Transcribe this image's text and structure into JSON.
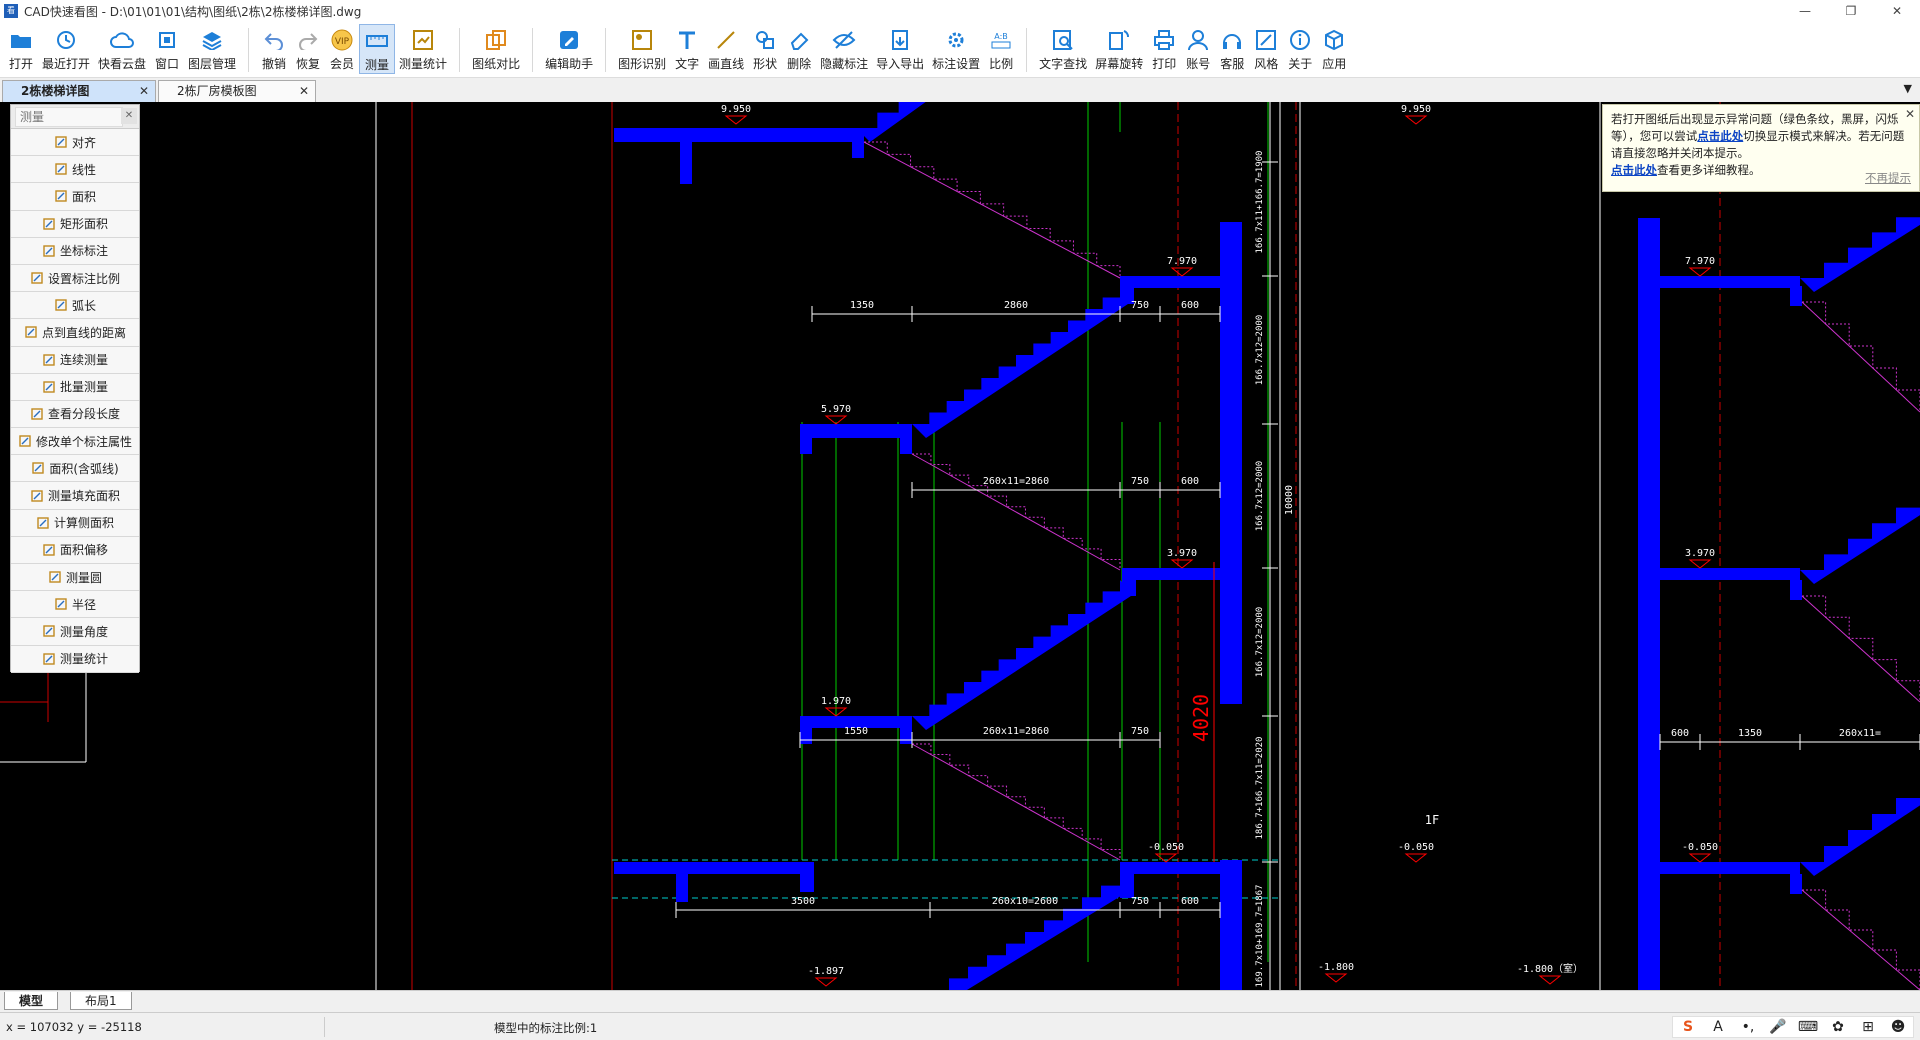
{
  "window": {
    "title": "CAD快速看图 - D:\\01\\01\\01\\结构\\图纸\\2栋\\2栋楼梯详图.dwg",
    "icon_label": "看图",
    "buttons": {
      "minimize": "—",
      "restore": "❐",
      "close": "✕"
    }
  },
  "toolbar": {
    "groups": [
      [
        {
          "label": "打开",
          "icon": "folder-icon"
        },
        {
          "label": "最近打开",
          "icon": "history-icon"
        },
        {
          "label": "快看云盘",
          "icon": "cloud-icon"
        },
        {
          "label": "窗口",
          "icon": "window-icon"
        },
        {
          "label": "图层管理",
          "icon": "layers-icon"
        }
      ],
      [
        {
          "label": "撤销",
          "icon": "undo-icon"
        },
        {
          "label": "恢复",
          "icon": "redo-icon"
        },
        {
          "label": "会员",
          "icon": "vip-icon"
        },
        {
          "label": "测量",
          "icon": "ruler-icon",
          "active": true
        },
        {
          "label": "测量统计",
          "icon": "measure-stats-icon"
        }
      ],
      [
        {
          "label": "图纸对比",
          "icon": "compare-icon"
        }
      ],
      [
        {
          "label": "编辑助手",
          "icon": "edit-assistant-icon"
        }
      ],
      [
        {
          "label": "图形识别",
          "icon": "shape-recognize-icon"
        },
        {
          "label": "文字",
          "icon": "text-icon"
        },
        {
          "label": "画直线",
          "icon": "line-icon"
        },
        {
          "label": "形状",
          "icon": "shape-icon"
        },
        {
          "label": "删除",
          "icon": "eraser-icon"
        },
        {
          "label": "隐藏标注",
          "icon": "hide-eye-icon"
        },
        {
          "label": "导入导出",
          "icon": "import-export-icon"
        },
        {
          "label": "标注设置",
          "icon": "annotation-settings-icon"
        },
        {
          "label": "比例",
          "icon": "scale-icon"
        }
      ],
      [
        {
          "label": "文字查找",
          "icon": "text-search-icon"
        },
        {
          "label": "屏幕旋转",
          "icon": "rotate-icon"
        },
        {
          "label": "打印",
          "icon": "print-icon"
        },
        {
          "label": "账号",
          "icon": "user-icon"
        },
        {
          "label": "客服",
          "icon": "headset-icon"
        },
        {
          "label": "风格",
          "icon": "style-icon"
        },
        {
          "label": "关于",
          "icon": "info-icon"
        },
        {
          "label": "应用",
          "icon": "cube-icon"
        }
      ]
    ]
  },
  "doc_tabs": [
    {
      "label": "2栋楼梯详图",
      "active": true,
      "close": "✕"
    },
    {
      "label": "2栋厂房模板图",
      "active": false,
      "close": "✕"
    }
  ],
  "doc_tabs_menu": "▼",
  "measure_panel": {
    "placeholder": "测量",
    "close": "✕",
    "items": [
      {
        "label": "对齐",
        "icon": "align-measure-icon"
      },
      {
        "label": "线性",
        "icon": "linear-measure-icon"
      },
      {
        "label": "面积",
        "icon": "area-icon"
      },
      {
        "label": "矩形面积",
        "icon": "rect-area-icon"
      },
      {
        "label": "坐标标注",
        "icon": "coordinate-icon"
      },
      {
        "label": "设置标注比例",
        "icon": "set-scale-icon"
      },
      {
        "label": "弧长",
        "icon": "arc-length-icon"
      },
      {
        "label": "点到直线的距离",
        "icon": "point-line-distance-icon"
      },
      {
        "label": "连续测量",
        "icon": "continuous-measure-icon"
      },
      {
        "label": "批量测量",
        "icon": "batch-measure-icon"
      },
      {
        "label": "查看分段长度",
        "icon": "segment-length-icon"
      },
      {
        "label": "修改单个标注属性",
        "icon": "edit-annotation-icon"
      },
      {
        "label": "面积(含弧线)",
        "icon": "arc-area-icon"
      },
      {
        "label": "测量填充面积",
        "icon": "fill-area-icon"
      },
      {
        "label": "计算侧面积",
        "icon": "side-area-icon"
      },
      {
        "label": "面积偏移",
        "icon": "area-offset-icon"
      },
      {
        "label": "测量圆",
        "icon": "circle-measure-icon"
      },
      {
        "label": "半径",
        "icon": "radius-icon"
      },
      {
        "label": "测量角度",
        "icon": "angle-icon"
      },
      {
        "label": "测量统计",
        "icon": "measure-stats-icon"
      }
    ]
  },
  "notice": {
    "line1": "若打开图纸后出现显示异常问题（绿色条纹，黑屏，闪烁等），您可以尝试",
    "link1": "点击此处",
    "line2": "切换显示模式来解决。若无问题请直接忽略并关闭本提示。",
    "link2": "点击此处",
    "line3": "查看更多详细教程。",
    "dismiss": "不再提示",
    "close": "✕"
  },
  "drawing": {
    "elevations": [
      "9.950",
      "9.950",
      "7.970",
      "7.970",
      "5.970",
      "3.970",
      "3.970",
      "1.970",
      "-0.050",
      "-0.050",
      "-0.050",
      "-1.897",
      "-1.800",
      "-1.800（室）"
    ],
    "dims": [
      "1350",
      "2860",
      "750",
      "600",
      "260x11=2860",
      "750",
      "600",
      "1550",
      "260x11=2860",
      "750",
      "3500",
      "260x10=2600",
      "750",
      "600",
      "600",
      "1350",
      "260x11="
    ],
    "vertical_dims": [
      "166.7x11+166.7=1900",
      "166.7x12=2000",
      "166.7x12=2000",
      "166.7x12=2000",
      "186.7+166.7x11=2020",
      "169.7x10+169.7=1867",
      "10000",
      "4020"
    ],
    "floor_label": "1F"
  },
  "bottom_tabs": [
    {
      "label": "模型",
      "active": true
    },
    {
      "label": "布局1",
      "active": false
    }
  ],
  "status": {
    "coords": "x = 107032  y = -25118",
    "scale": "模型中的标注比例:1"
  },
  "tray": [
    "S",
    "A",
    "•,",
    "🎤",
    "⌨",
    "✿",
    "⊞",
    "☻"
  ],
  "colors": {
    "structure": "#0000ff",
    "dim": "#ffffff",
    "elevation_mark": "#ff0000",
    "stair_hatch": "#cc33cc",
    "grid": "#00cc00",
    "axis": "#cc0000"
  }
}
